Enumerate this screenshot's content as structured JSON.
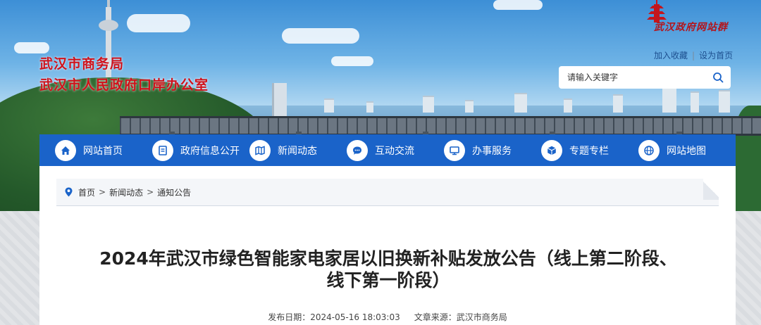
{
  "header": {
    "org_name_1": "武汉市商务局",
    "org_name_2": "武汉市人民政府口岸办公室",
    "logo_text": "武汉政府网站群",
    "links": {
      "bookmark": "加入收藏",
      "separator": "|",
      "homepage": "设为首页"
    },
    "search": {
      "placeholder": "请输入关键字",
      "icon": "search-icon"
    }
  },
  "nav": {
    "items": [
      {
        "label": "网站首页",
        "icon": "home-icon"
      },
      {
        "label": "政府信息公开",
        "icon": "document-icon"
      },
      {
        "label": "新闻动态",
        "icon": "map-book-icon"
      },
      {
        "label": "互动交流",
        "icon": "chat-icon"
      },
      {
        "label": "办事服务",
        "icon": "monitor-icon"
      },
      {
        "label": "专题专栏",
        "icon": "cube-icon"
      },
      {
        "label": "网站地图",
        "icon": "globe-icon"
      }
    ]
  },
  "breadcrumb": {
    "icon": "location-pin-icon",
    "items": [
      "首页",
      "新闻动态",
      "通知公告"
    ],
    "separator": ">"
  },
  "article": {
    "title": "2024年武汉市绿色智能家电家居以旧换新补贴发放公告（线上第二阶段、线下第一阶段）",
    "publish_label": "发布日期：",
    "publish_date": "2024-05-16 18:03:03",
    "source_label": "文章来源：",
    "source": "武汉市商务局"
  },
  "colors": {
    "nav_blue": "#1a63c9",
    "title_red": "#d0121b",
    "link_blue": "#1d4f8f"
  }
}
